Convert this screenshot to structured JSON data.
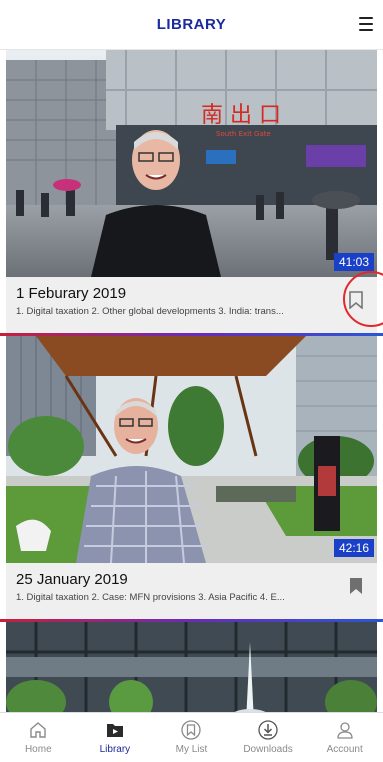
{
  "header": {
    "title": "LIBRARY",
    "menu_icon": "hamburger-menu-icon"
  },
  "episodes": [
    {
      "date": "1 Feburary 2019",
      "description": "1. Digital taxation 2. Other global developments 3. India: trans...",
      "duration": "41:03",
      "bookmarked": false
    },
    {
      "date": "25 January 2019",
      "description": "1. Digital taxation 2. Case: MFN provisions 3. Asia Pacific 4. E...",
      "duration": "42:16",
      "bookmarked": true
    }
  ],
  "thumbnail_signs": {
    "station_sign": "南 出 口",
    "station_sub": "South Exit Gate"
  },
  "tabs": [
    {
      "label": "Home",
      "icon": "home-icon",
      "active": false
    },
    {
      "label": "Library",
      "icon": "folder-icon",
      "active": true
    },
    {
      "label": "My List",
      "icon": "bookmark-list-icon",
      "active": false
    },
    {
      "label": "Downloads",
      "icon": "download-icon",
      "active": false
    },
    {
      "label": "Account",
      "icon": "user-icon",
      "active": false
    }
  ],
  "colors": {
    "brand_blue": "#1b2a9c",
    "duration_badge": "#1a40c8",
    "highlight": "#e3272b"
  }
}
